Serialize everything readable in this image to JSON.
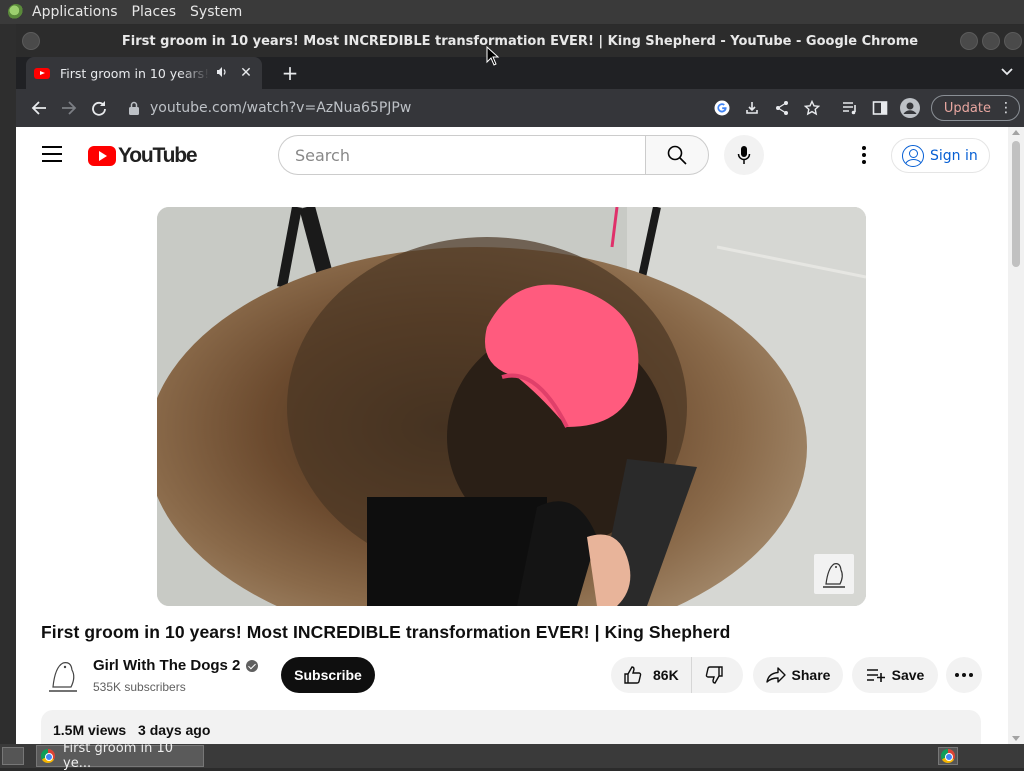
{
  "top_panel": {
    "menus": [
      "Applications",
      "Places",
      "System"
    ]
  },
  "window": {
    "title": "First groom in 10 years! Most INCREDIBLE transformation EVER! | King Shepherd - YouTube - Google Chrome"
  },
  "tab": {
    "title": "First groom in 10 years! Most INCREDIBLE transformation EVER! | King Shepherd - YouTube",
    "favicon": "youtube-icon",
    "audio_icon": "speaker-icon"
  },
  "toolbar": {
    "url": "youtube.com/watch?v=AzNua65PJPw",
    "update_label": "Update"
  },
  "youtube": {
    "logo_text": "YouTube",
    "search_placeholder": "Search",
    "signin_label": "Sign in"
  },
  "video": {
    "title": "First groom in 10 years! Most INCREDIBLE transformation EVER! | King Shepherd",
    "channel_name": "Girl With The Dogs 2",
    "subscribers": "535K subscribers",
    "subscribe_label": "Subscribe",
    "likes": "86K",
    "share_label": "Share",
    "save_label": "Save",
    "views": "1.5M views",
    "published": "3 days ago"
  },
  "taskbar": {
    "task_label": "First groom in 10 ye..."
  },
  "colors": {
    "youtube_red": "#ff0000",
    "link_blue": "#065fd4",
    "chrome_dark": "#35363a"
  }
}
